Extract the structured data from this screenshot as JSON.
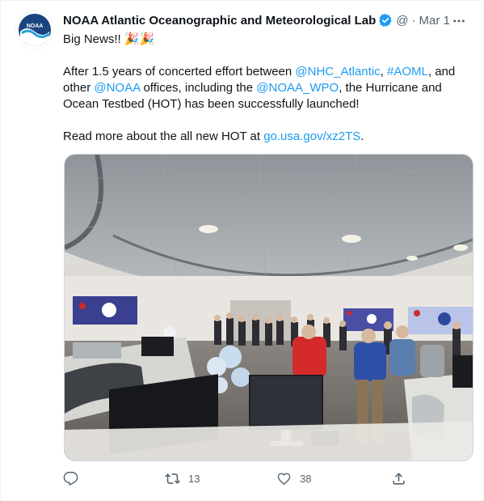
{
  "tweet": {
    "author_name": "NOAA Atlantic Oceanographic and Meteorological Lab",
    "handle": "@",
    "separator": "·",
    "date": "Mar 1",
    "avatar_text": "NOAA",
    "text": {
      "line1": "Big News!! 🎉🎉",
      "p2_a": "After 1.5 years of concerted effort between ",
      "mention_nhc": "@NHC_Atlantic",
      "p2_b": ", ",
      "hashtag_aoml": "#AOML",
      "p2_c": ", and other ",
      "mention_noaa": "@NOAA",
      "p2_d": " offices, including the ",
      "mention_wpo": "@NOAA_WPO",
      "p2_e": ", the Hurricane and Ocean Testbed (HOT) has been successfully launched!",
      "p3_a": "Read more about the all new HOT at ",
      "link": "go.usa.gov/xz2TS",
      "p3_b": "."
    },
    "photo": {
      "description_icon": "photo-of-testbed-room"
    },
    "actions": {
      "reply_count": "",
      "retweet_count": "13",
      "like_count": "38"
    }
  },
  "colors": {
    "link": "#1d9bf0",
    "muted": "#536471",
    "verified": "#1d9bf0",
    "noaa_blue": "#1a4480"
  }
}
